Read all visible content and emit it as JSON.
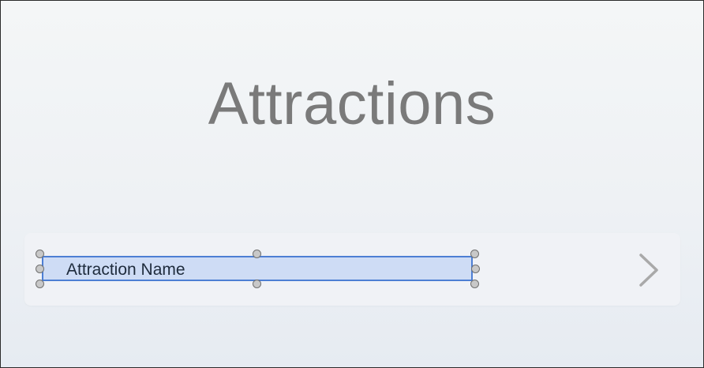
{
  "screen": {
    "title": "Attractions"
  },
  "table": {
    "rows": [
      {
        "label": "Attraction Name",
        "accessory": "chevron-right-icon"
      }
    ]
  },
  "selection": {
    "selected_element": "Attraction Name"
  },
  "colors": {
    "title": "#7a7a7a",
    "selection_fill": "#bacef3",
    "selection_border": "#4d7fd4",
    "label_text": "#1e2b3c",
    "cell_background": "#f0f2f6",
    "chevron": "#a9a9a9"
  }
}
